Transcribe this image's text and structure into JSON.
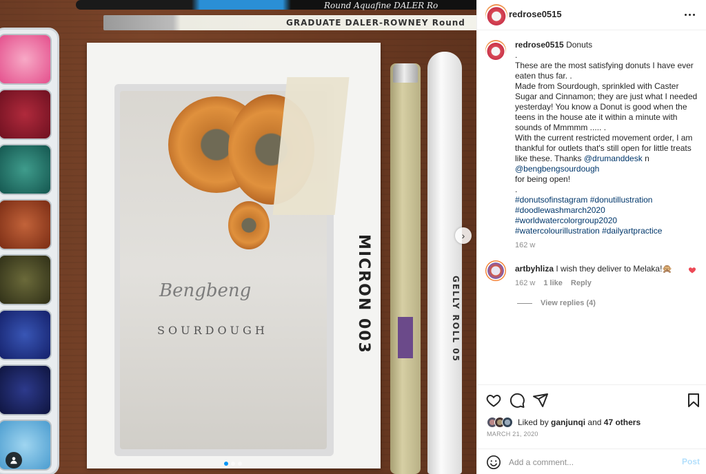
{
  "post": {
    "username": "redrose0515",
    "more_icon": "more-horizontal-icon"
  },
  "photo": {
    "brush1_text": "Round  Aquafine  DALER  Ro",
    "brush2_text": "GRADUATE  DALER-ROWNEY  Round",
    "art_line1": "Bengbeng",
    "art_line2": "SOURDOUGH",
    "pen1_text": "MICRON 003",
    "pen2_text": "GELLY ROLL 05",
    "next_icon": "chevron-right-icon",
    "tag_icon": "user-tag-icon"
  },
  "caption": {
    "username": "redrose0515",
    "title": "Donuts",
    "lines": [
      ".",
      "These are the most satisfying donuts I have ever eaten thus far. .",
      "Made from Sourdough, sprinkled with Caster Sugar and Cinnamon; they are just what I needed yesterday! You know a Donut is good when the teens in the house ate it within a minute with sounds of Mmmmm ..... .",
      "With the current restricted movement order, I am thankful for outlets that's still open for little treats like these. Thanks"
    ],
    "mention1": "@drumanddesk",
    "mention_joiner": "n",
    "mention2": "@bengbengsourdough",
    "after_mentions": "for being open!",
    "dot_line": ".",
    "hashtags_line1a": "#donutsofinstagram",
    "hashtags_line1b": "#donutillustration",
    "hashtags_line2": "#doodlewashmarch2020",
    "hashtags_line3": "#worldwatercolorgroup2020",
    "hashtags_line4a": "#watercolourillustration",
    "hashtags_line4b": "#dailyartpractice",
    "time": "162 w"
  },
  "comment": {
    "username": "artbyhliza",
    "text": "I wish they deliver to Melaka!🙊",
    "time": "162 w",
    "likes": "1 like",
    "reply_label": "Reply",
    "view_replies": "View replies (4)",
    "heart_color": "#ed4956"
  },
  "actions": {
    "like_icon": "heart-icon",
    "comment_icon": "comment-icon",
    "share_icon": "send-icon",
    "save_icon": "bookmark-icon",
    "liked_by_prefix": "Liked by",
    "liked_by_user": "ganjunqi",
    "liked_by_and": "and",
    "liked_by_others": "47 others",
    "date": "MARCH 21, 2020"
  },
  "add_comment": {
    "placeholder": "Add a comment...",
    "post_label": "Post",
    "emoji_icon": "smiley-icon",
    "post_color_disabled": "#b2dffc"
  }
}
